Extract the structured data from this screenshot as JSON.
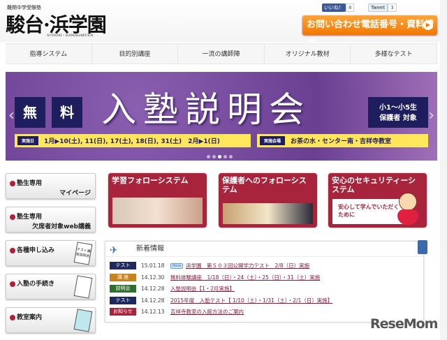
{
  "header": {
    "logo_small": "難関中学受験塾",
    "logo_main": "駿台·浜学園",
    "logo_sub": "SUNDAI・HAMAGAKUEN",
    "fb_label": "いいね！",
    "fb_count": "8",
    "tweet_label": "Tweet",
    "tweet_count": "3",
    "contact_label": "お問い合わせ電話番号・資料請求"
  },
  "nav": [
    "指導システム",
    "目的別講座",
    "一流の講師陣",
    "オリジナル教材",
    "多様なテスト"
  ],
  "banner": {
    "free1": "無",
    "free2": "料",
    "title": "入塾説明会",
    "target1": "小1～小5生",
    "target2": "保護者 対象",
    "date_label": "実施日",
    "dates": "1月▶10(土), 11(日), 17(土), 18(日), 31(土)　2月▶1(日)",
    "venue_label": "実施会場",
    "venue": "お茶の水・センター南・吉祥寺教室",
    "active_slide": 3,
    "slide_count": 5
  },
  "left_buttons": [
    {
      "l1": "塾生専用",
      "l2": "マイページ"
    },
    {
      "l1": "塾生専用",
      "l2": "欠席者対象web講義"
    },
    {
      "l1": "各種申し込み",
      "deco": "テスト講座説明会"
    },
    {
      "l1": "入塾の手続き"
    },
    {
      "l1": "教室案内"
    }
  ],
  "cards": [
    {
      "title": "学習フォローシステム"
    },
    {
      "title": "保護者へのフォローシステム"
    },
    {
      "title": "安心のセキュリティーシステム",
      "sub": "安心して学んでいただくために"
    }
  ],
  "news": {
    "title": "新着情報",
    "new_badge": "New",
    "items": [
      {
        "cat": "テスト",
        "color": "#1e2a5e",
        "date": "15.01.18",
        "new": true,
        "text": "浜学園　第５０３回公開学力テスト　2/8（日）実施"
      },
      {
        "cat": "講 座",
        "color": "#c8821e",
        "date": "14.12.30",
        "text": "無料体験講座　1/18（日）・24（土）・25（日）・31（土）実施"
      },
      {
        "cat": "説明会",
        "color": "#2e6e2e",
        "date": "14.12.28",
        "text": "入塾説明会【1・2月実施】"
      },
      {
        "cat": "テスト",
        "color": "#1e2a5e",
        "date": "14.12.28",
        "text": "2015年度　入塾テスト【 1/10（土）・1/31（土）・2/1（日）実施】"
      },
      {
        "cat": "お知らせ",
        "color": "#a8243c",
        "date": "14.12.13",
        "text": "吉祥寺教室の入館方法のご案内"
      }
    ]
  },
  "watermark": "ReseMom"
}
